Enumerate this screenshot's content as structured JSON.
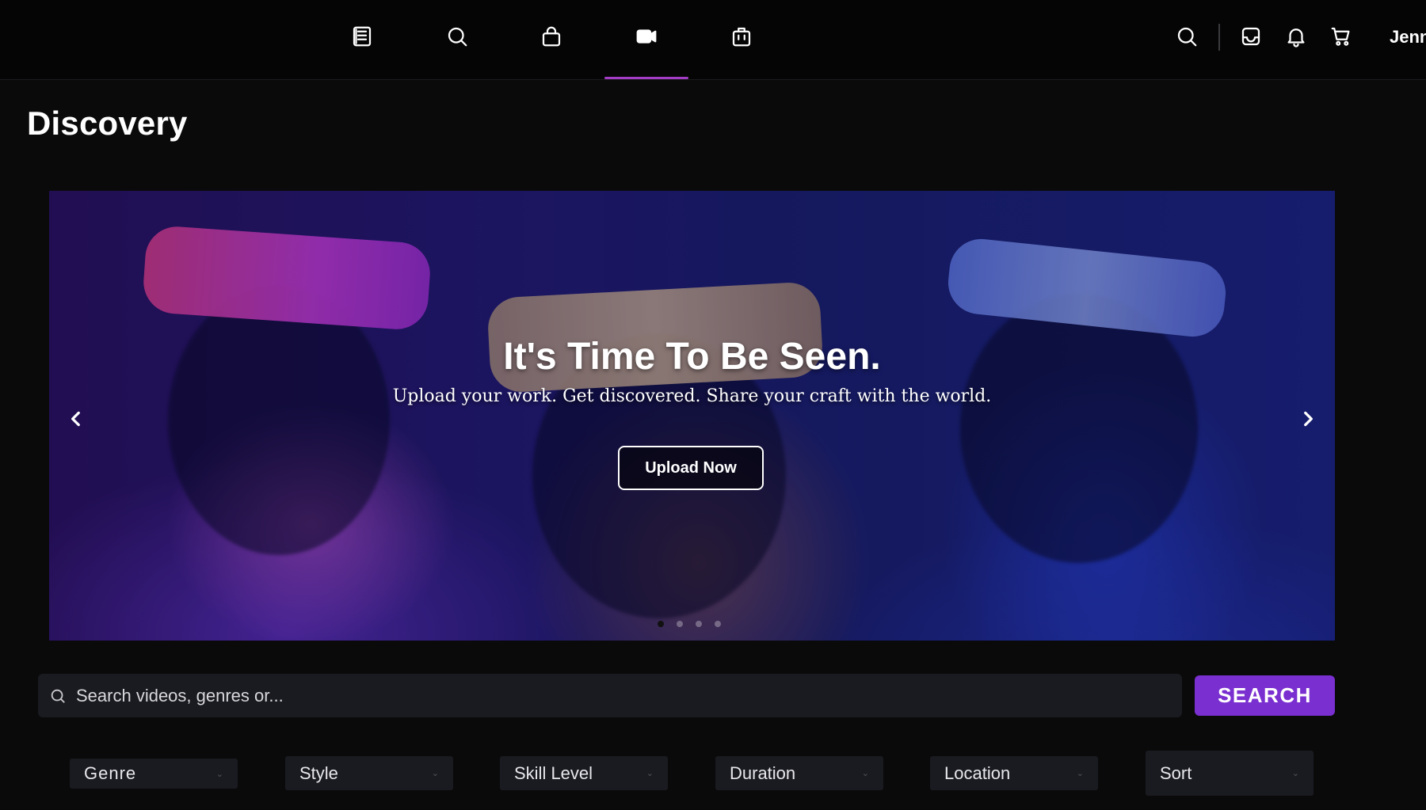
{
  "nav": {
    "icons": [
      "newspaper-icon",
      "search-icon",
      "shopping-bag-icon",
      "video-camera-icon",
      "briefcase-icon"
    ],
    "active": "video-camera-icon",
    "right_icons": [
      "search-icon",
      "inbox-icon",
      "bell-icon",
      "cart-icon"
    ],
    "user_name": "Jenn"
  },
  "page": {
    "title": "Discovery"
  },
  "hero": {
    "title": "It's Time To Be Seen.",
    "subtitle": "Upload your work. Get discovered. Share your craft with the world.",
    "cta_label": "Upload Now",
    "slide_count": 4,
    "active_slide": 1
  },
  "search": {
    "placeholder": "Search videos, genres or...",
    "button_label": "SEARCH"
  },
  "filters": [
    {
      "label": "Genre"
    },
    {
      "label": "Style"
    },
    {
      "label": "Skill Level"
    },
    {
      "label": "Duration"
    },
    {
      "label": "Location"
    },
    {
      "label": "Sort"
    }
  ],
  "colors": {
    "accent": "#7a2fd0",
    "active_underline": "#a33cc4",
    "background": "#0a0a0b"
  }
}
